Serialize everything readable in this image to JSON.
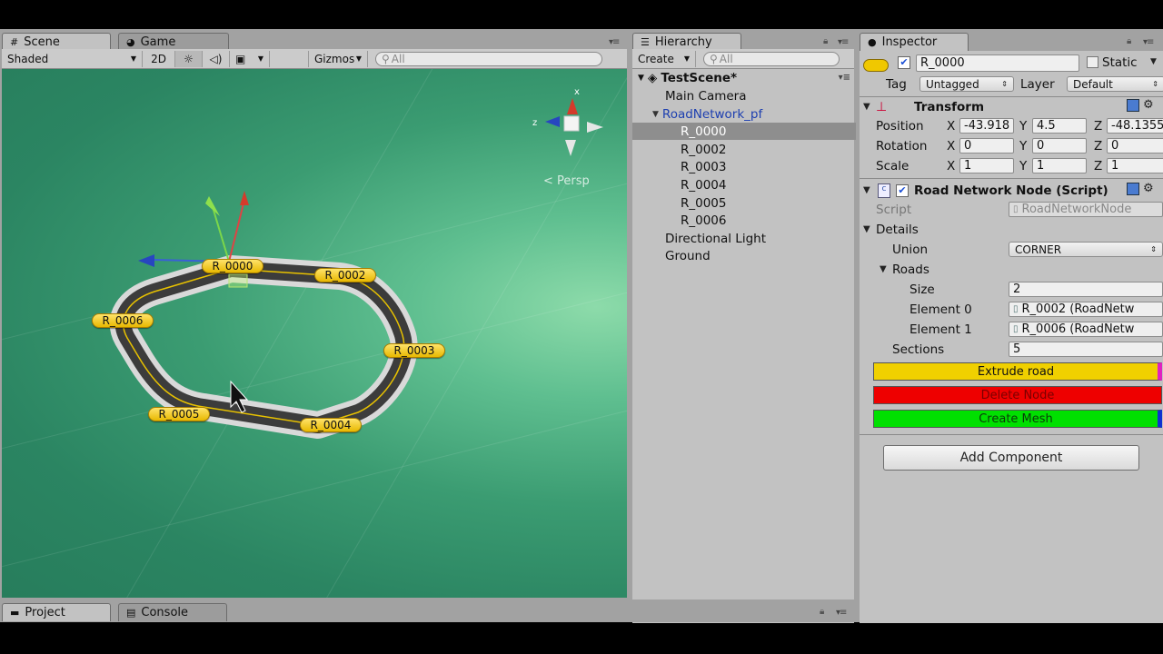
{
  "scene_panel": {
    "tabs": [
      {
        "label": "Scene",
        "icon": "grid-icon"
      },
      {
        "label": "Game",
        "icon": "pacman-icon"
      }
    ],
    "toolbar": {
      "shading_mode": "Shaded",
      "mode_2d": "2D",
      "gizmos_label": "Gizmos",
      "search_placeholder": "All"
    },
    "projection_label": "< Persp",
    "nodes": [
      {
        "label": "R_0000"
      },
      {
        "label": "R_0002"
      },
      {
        "label": "R_0006"
      },
      {
        "label": "R_0003"
      },
      {
        "label": "R_0005"
      },
      {
        "label": "R_0004"
      }
    ],
    "colors": {
      "scene_bg": "#2b8562",
      "label_bg": "#f3cd24",
      "road_edge": "#d9d9d9",
      "road_surface": "#3a3a3a"
    }
  },
  "hierarchy": {
    "title": "Hierarchy",
    "create_label": "Create",
    "search_placeholder": "All",
    "scene_name": "TestScene*",
    "items": [
      {
        "label": "Main Camera"
      },
      {
        "label": "RoadNetwork_pf"
      },
      {
        "label": "R_0000"
      },
      {
        "label": "R_0002"
      },
      {
        "label": "R_0003"
      },
      {
        "label": "R_0004"
      },
      {
        "label": "R_0005"
      },
      {
        "label": "R_0006"
      },
      {
        "label": "Directional Light"
      },
      {
        "label": "Ground"
      }
    ],
    "selected": "R_0000"
  },
  "inspector": {
    "title": "Inspector",
    "object_name": "R_0000",
    "active": true,
    "static_label": "Static",
    "tag_label": "Tag",
    "tag_value": "Untagged",
    "layer_label": "Layer",
    "layer_value": "Default",
    "transform": {
      "title": "Transform",
      "position_label": "Position",
      "rotation_label": "Rotation",
      "scale_label": "Scale",
      "position": {
        "x": "-43.918",
        "y": "4.5",
        "z": "-48.1355"
      },
      "rotation": {
        "x": "0",
        "y": "0",
        "z": "0"
      },
      "scale": {
        "x": "1",
        "y": "1",
        "z": "1"
      }
    },
    "script_component": {
      "title": "Road Network Node (Script)",
      "script_label": "Script",
      "script_value": "RoadNetworkNode",
      "details_label": "Details",
      "union_label": "Union",
      "union_value": "CORNER",
      "roads_label": "Roads",
      "size_label": "Size",
      "size_value": "2",
      "element0_label": "Element 0",
      "element0_value": "R_0002 (RoadNetw",
      "element1_label": "Element 1",
      "element1_value": "R_0006 (RoadNetw",
      "sections_label": "Sections",
      "sections_value": "5"
    },
    "buttons": {
      "extrude": "Extrude road",
      "delete": "Delete Node",
      "create_mesh": "Create Mesh",
      "add_component": "Add Component"
    },
    "colors": {
      "extrude": "#f0d000",
      "delete": "#ee0000",
      "create_mesh": "#00e000"
    }
  },
  "bottom_panel": {
    "tabs": [
      {
        "label": "Project",
        "icon": "folder-icon"
      },
      {
        "label": "Console",
        "icon": "console-icon"
      }
    ]
  }
}
